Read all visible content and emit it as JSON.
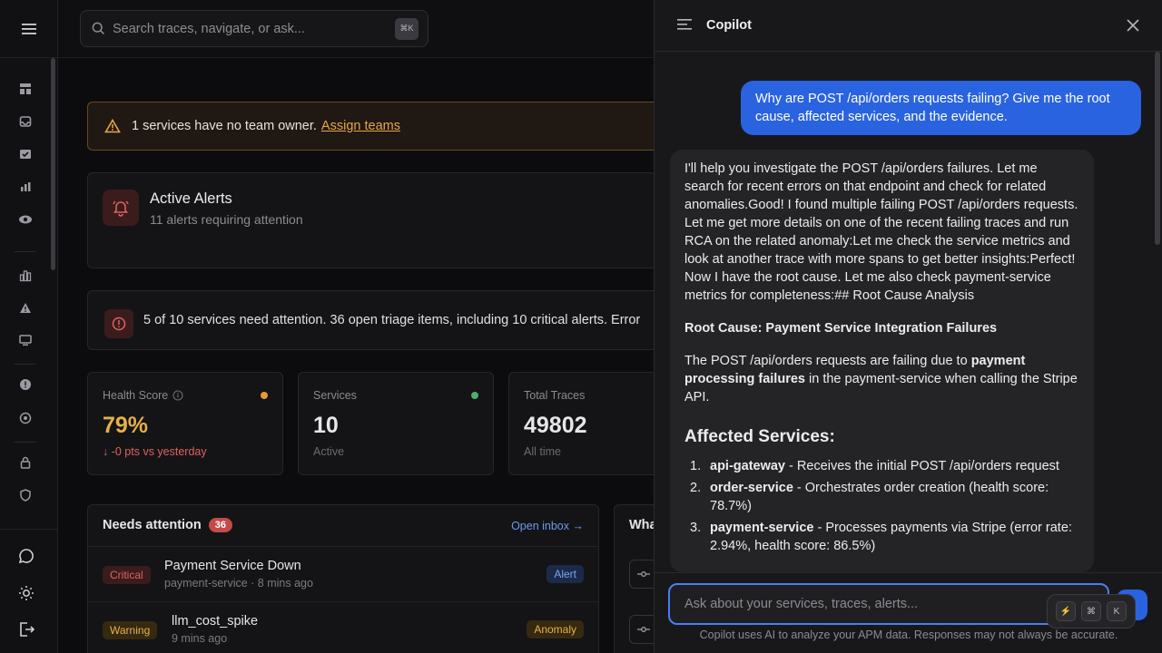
{
  "search": {
    "placeholder": "Search traces, navigate, or ask...",
    "shortcut": "⌘K"
  },
  "banner": {
    "text": "1 services have no team owner.",
    "link": "Assign teams"
  },
  "active_alerts": {
    "title": "Active Alerts",
    "subtitle": "11 alerts requiring attention"
  },
  "summary": {
    "text": "5 of 10 services need attention. 36 open triage items, including 10 critical alerts. Error"
  },
  "stats": [
    {
      "label": "Health Score",
      "value": "79%",
      "foot": "↓ -0 pts vs yesterday",
      "dot_color": "#e8973a",
      "value_color": "#e6b04a",
      "foot_color": "#e06060"
    },
    {
      "label": "Services",
      "value": "10",
      "foot": "Active",
      "dot_color": "#4caf6a",
      "value_color": "#e6e6e8",
      "foot_color": "#6a6a72"
    },
    {
      "label": "Total Traces",
      "value": "49802",
      "foot": "All time",
      "value_color": "#e6e6e8",
      "foot_color": "#6a6a72"
    }
  ],
  "needs_attention": {
    "title": "Needs attention",
    "count": "36",
    "open_inbox": "Open inbox →",
    "rows": [
      {
        "severity": "Critical",
        "title": "Payment Service Down",
        "meta": "payment-service · 8 mins ago",
        "tag": "Alert"
      },
      {
        "severity": "Warning",
        "title": "llm_cost_spike",
        "meta": "9 mins ago",
        "tag": "Anomaly"
      }
    ]
  },
  "side_card": {
    "title_partial": "Wha"
  },
  "copilot": {
    "title": "Copilot",
    "user_message": "Why are POST /api/orders requests failing? Give me the root cause, affected services, and the evidence.",
    "bot": {
      "intro": "I'll help you investigate the POST /api/orders failures. Let me search for recent errors on that endpoint and check for related anomalies.Good! I found multiple failing POST /api/orders requests. Let me get more details on one of the recent failing traces and run RCA on the related anomaly:Let me check the service metrics and look at another trace with more spans to get better insights:Perfect! Now I have the root cause. Let me also check payment-service metrics for completeness:## Root Cause Analysis",
      "root_cause_heading": "Root Cause: Payment Service Integration Failures",
      "root_cause_pre": "The POST /api/orders requests are failing due to",
      "root_cause_bold": "payment processing failures",
      "root_cause_post": "in the payment-service when calling the Stripe API.",
      "affected_heading": "Affected Services:",
      "affected": [
        {
          "num": "1.",
          "name": "api-gateway",
          "desc": " - Receives the initial POST /api/orders request"
        },
        {
          "num": "2.",
          "name": "order-service",
          "desc": " - Orchestrates order creation (health score: 78.7%)"
        },
        {
          "num": "3.",
          "name": "payment-service",
          "desc": " - Processes payments via Stripe (error rate: 2.94%, health score: 86.5%)"
        }
      ]
    },
    "input_placeholder": "Ask about your services, traces, alerts...",
    "kbar": [
      "⚡",
      "⌘",
      "K"
    ],
    "disclaimer": "Copilot uses AI to analyze your APM data. Responses may not always be accurate."
  }
}
